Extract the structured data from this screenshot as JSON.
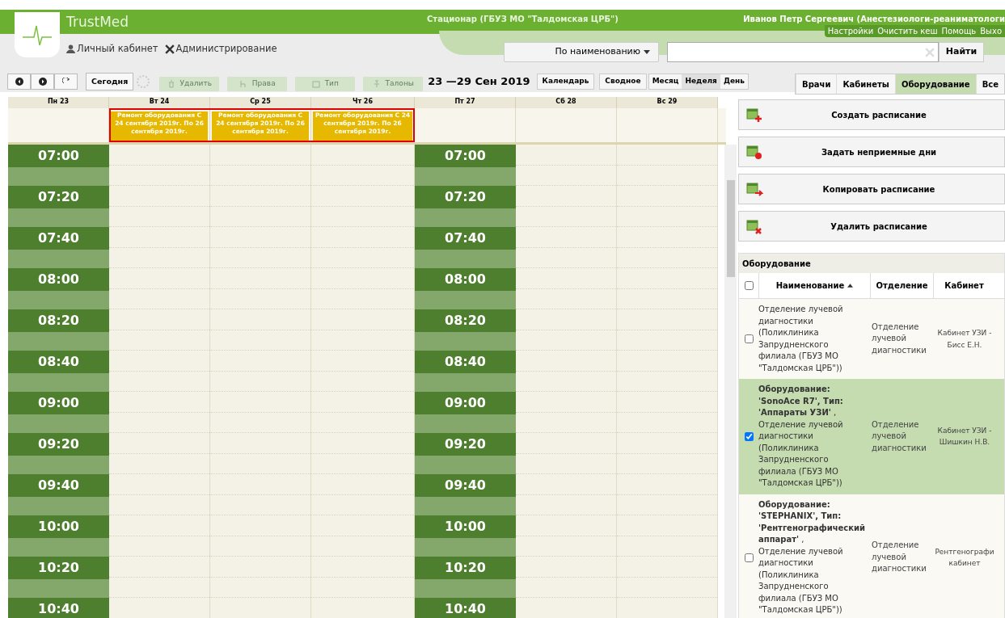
{
  "header": {
    "app_name": "TrustMed",
    "organization": "Стационар (ГБУЗ МО \"Талдомская ЦРБ\")",
    "user": "Иванов Петр Сергеевич (Анестезиологи-реаниматологи",
    "links": [
      "Настройки",
      "Очистить кеш",
      "Помощь",
      "Выхо"
    ],
    "nav": [
      {
        "kind": "user",
        "label": "Личный кабинет"
      },
      {
        "kind": "tools",
        "label": "Администрирование"
      }
    ]
  },
  "search": {
    "mode": "По наименованию",
    "button": "Найти"
  },
  "toolbar": {
    "today": "Сегодня",
    "actions": [
      {
        "kind": "delete",
        "label": "Удалить",
        "disabled": true
      },
      {
        "kind": "rights",
        "label": "Права",
        "disabled": true
      },
      {
        "kind": "type",
        "label": "Тип",
        "disabled": true
      },
      {
        "kind": "pin",
        "label": "Талоны",
        "disabled": true
      }
    ],
    "date_range": "23 —29 Сен 2019",
    "views": [
      "Календарь",
      "Сводное"
    ],
    "periods": [
      {
        "label": "Месяц",
        "selected": false
      },
      {
        "label": "Неделя",
        "selected": true
      },
      {
        "label": "День",
        "selected": false
      }
    ]
  },
  "tabs": [
    {
      "label": "Врачи",
      "selected": false
    },
    {
      "label": "Кабинеты",
      "selected": false
    },
    {
      "label": "Оборудование",
      "selected": true
    },
    {
      "label": "Все",
      "selected": false
    }
  ],
  "calendar": {
    "events_highlighted": true,
    "days": [
      {
        "label": "Пн 23",
        "kind": "time",
        "times": [
          "07:00",
          "07:20",
          "07:40",
          "08:00",
          "08:20",
          "08:40",
          "09:00",
          "09:20",
          "09:40",
          "10:00",
          "10:20",
          "10:40"
        ]
      },
      {
        "label": "Вт 24",
        "kind": "slots",
        "event": "Ремонт оборудования С 24 сентября 2019г. По 26 сентября 2019г."
      },
      {
        "label": "Ср 25",
        "kind": "slots",
        "event": "Ремонт оборудования С 24 сентября 2019г. По 26 сентября 2019г."
      },
      {
        "label": "Чт 26",
        "kind": "slots",
        "event": "Ремонт оборудования С 24 сентября 2019г. По 26 сентября 2019г."
      },
      {
        "label": "Пт 27",
        "kind": "time",
        "times": [
          "07:00",
          "07:20",
          "07:40",
          "08:00",
          "08:20",
          "08:40",
          "09:00",
          "09:20",
          "09:40",
          "10:00",
          "10:20",
          "10:40"
        ]
      },
      {
        "label": "Сб 28",
        "kind": "slots"
      },
      {
        "label": "Вс 29",
        "kind": "slots"
      }
    ]
  },
  "schedule_actions": [
    {
      "kind": "create",
      "label": "Создать расписание"
    },
    {
      "kind": "block",
      "label": "Задать неприемные дни"
    },
    {
      "kind": "copy",
      "label": "Копировать расписание"
    },
    {
      "kind": "delete",
      "label": "Удалить расписание"
    }
  ],
  "equipment": {
    "title": "Оборудование",
    "header_checked": false,
    "columns": [
      "Наименование",
      "Отделение",
      "Кабинет"
    ],
    "rows": [
      {
        "name": "",
        "text": "Отделение лучевой диагностики (Поликлиника Запрудненского филиала (ГБУЗ МО \"Талдомская ЦРБ\"))",
        "department": "Отделение лучевой диагностики",
        "cabinet": "Кабинет УЗИ - Бисс Е.Н.",
        "checked": false,
        "selected": false
      },
      {
        "name": "**Оборудование: 'SonoAce R7', Тип: 'Аппараты УЗИ'** ,",
        "text": "Отделение лучевой диагностики (Поликлиника Запрудненского филиала (ГБУЗ МО \"Талдомская ЦРБ\"))",
        "department": "Отделение лучевой диагностики",
        "cabinet": "Кабинет УЗИ - Шишкин Н.В.",
        "checked": true,
        "selected": true
      },
      {
        "name": "**Оборудование: 'STEPHANIX', Тип: 'Рентгенографический аппарат'** ,",
        "text": "Отделение лучевой диагностики (Поликлиника Запрудненского филиала (ГБУЗ МО \"Талдомская ЦРБ\"))",
        "department": "Отделение лучевой диагностики",
        "cabinet": "Рентгенографи кабинет",
        "checked": false,
        "selected": false
      }
    ]
  }
}
